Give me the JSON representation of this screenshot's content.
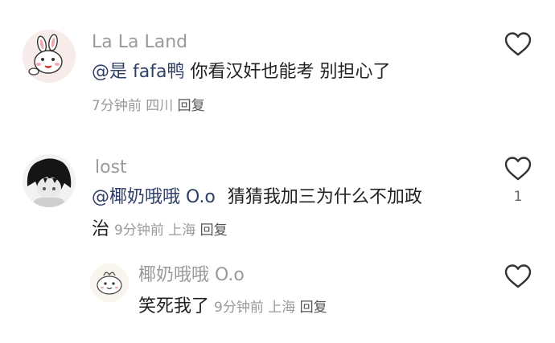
{
  "comments": [
    {
      "username": "La La Land",
      "mention": "@是 fafa鸭",
      "text": " 你看汉奸也能考 别担心了",
      "time": "7分钟前",
      "location": "四川",
      "reply_label": "回复",
      "avatar_icon": "bunny-avatar-icon"
    },
    {
      "username": "lost",
      "mention": "@椰奶哦哦 O.o",
      "text_line1": "猜猜我加三为什么不加政",
      "text_line2": "治",
      "time": "9分钟前",
      "location": "上海",
      "reply_label": "回复",
      "like_count": "1",
      "avatar_icon": "dark-hair-avatar-icon"
    }
  ],
  "reply": {
    "username": "椰奶哦哦 O.o",
    "text": "笑死我了",
    "time": "9分钟前",
    "location": "上海",
    "reply_label": "回复",
    "avatar_icon": "doodle-avatar-icon"
  }
}
